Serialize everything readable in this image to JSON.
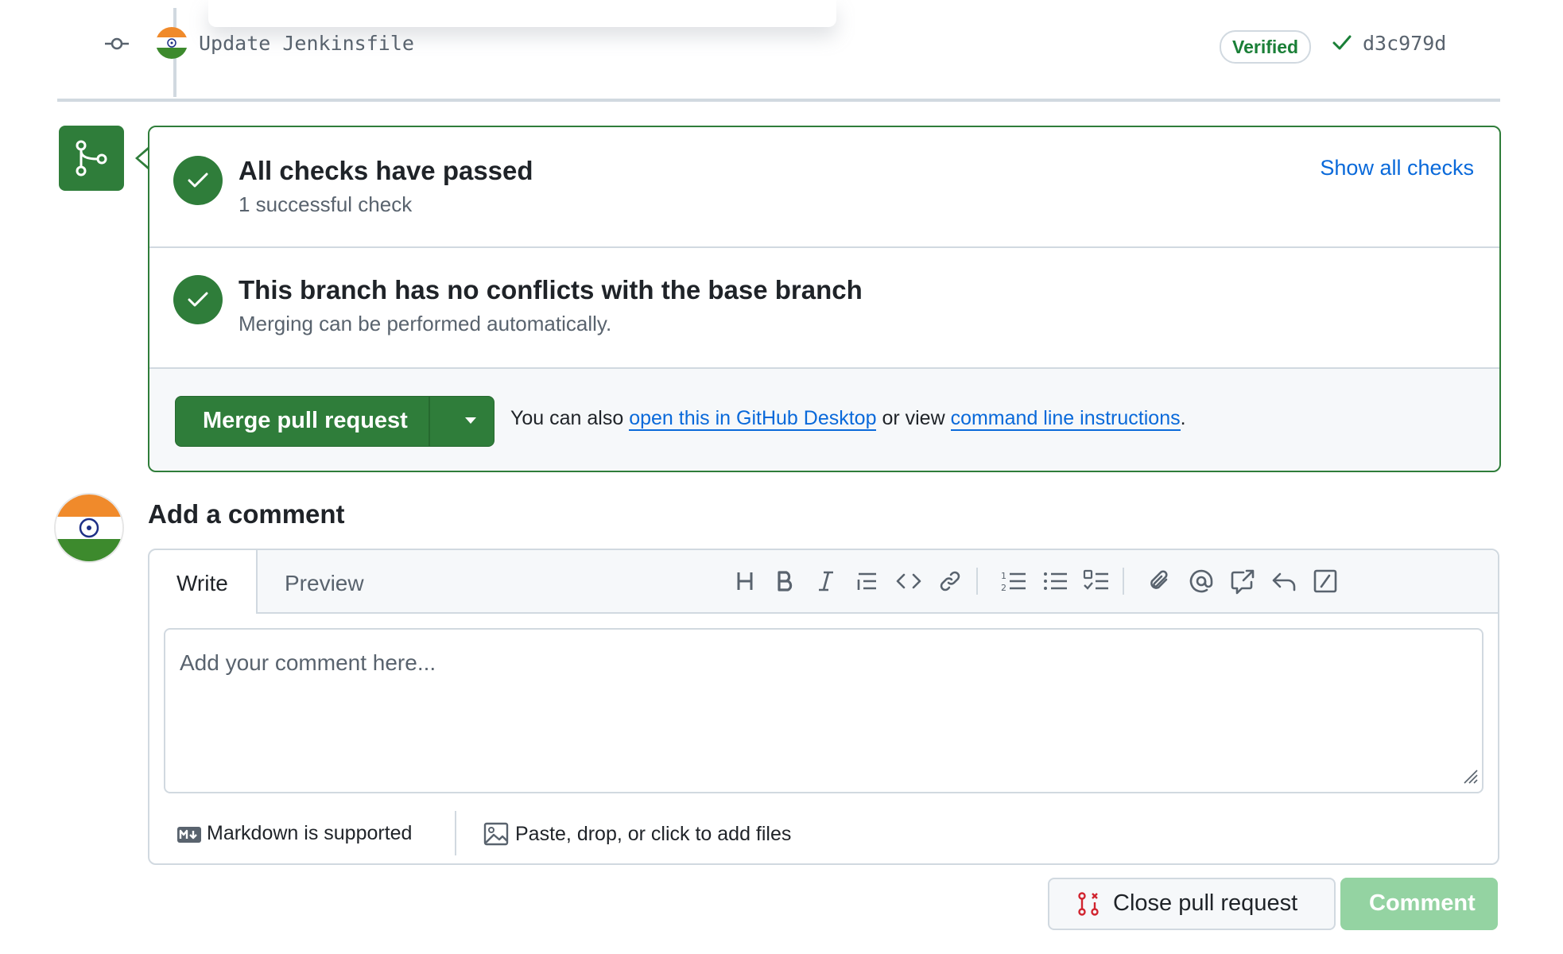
{
  "commit": {
    "message": "Update Jenkinsfile",
    "verified_label": "Verified",
    "sha": "d3c979d"
  },
  "checks": {
    "title": "All checks have passed",
    "subtitle": "1 successful check",
    "show_all_label": "Show all checks"
  },
  "conflicts": {
    "title": "This branch has no conflicts with the base branch",
    "subtitle": "Merging can be performed automatically."
  },
  "merge": {
    "button_label": "Merge pull request",
    "info_prefix": "You can also",
    "desktop_link": "open this in GitHub Desktop",
    "info_middle": "or view",
    "cli_link": "command line instructions",
    "info_suffix": "."
  },
  "comment": {
    "heading": "Add a comment",
    "tab_write": "Write",
    "tab_preview": "Preview",
    "placeholder": "Add your comment here...",
    "markdown_note": "Markdown is supported",
    "files_note": "Paste, drop, or click to add files",
    "toolbar_icons": [
      "heading-icon",
      "bold-icon",
      "italic-icon",
      "quote-icon",
      "code-icon",
      "link-icon",
      "ordered-list-icon",
      "unordered-list-icon",
      "task-list-icon",
      "attach-icon",
      "mention-icon",
      "cross-reference-icon",
      "saved-reply-icon",
      "slash-command-icon"
    ]
  },
  "actions": {
    "close_label": "Close pull request",
    "comment_label": "Comment"
  },
  "colors": {
    "success_green": "#2f7d3a",
    "link_blue": "#0969da",
    "disabled_green": "#94d3a2",
    "danger_red": "#d1242f"
  }
}
